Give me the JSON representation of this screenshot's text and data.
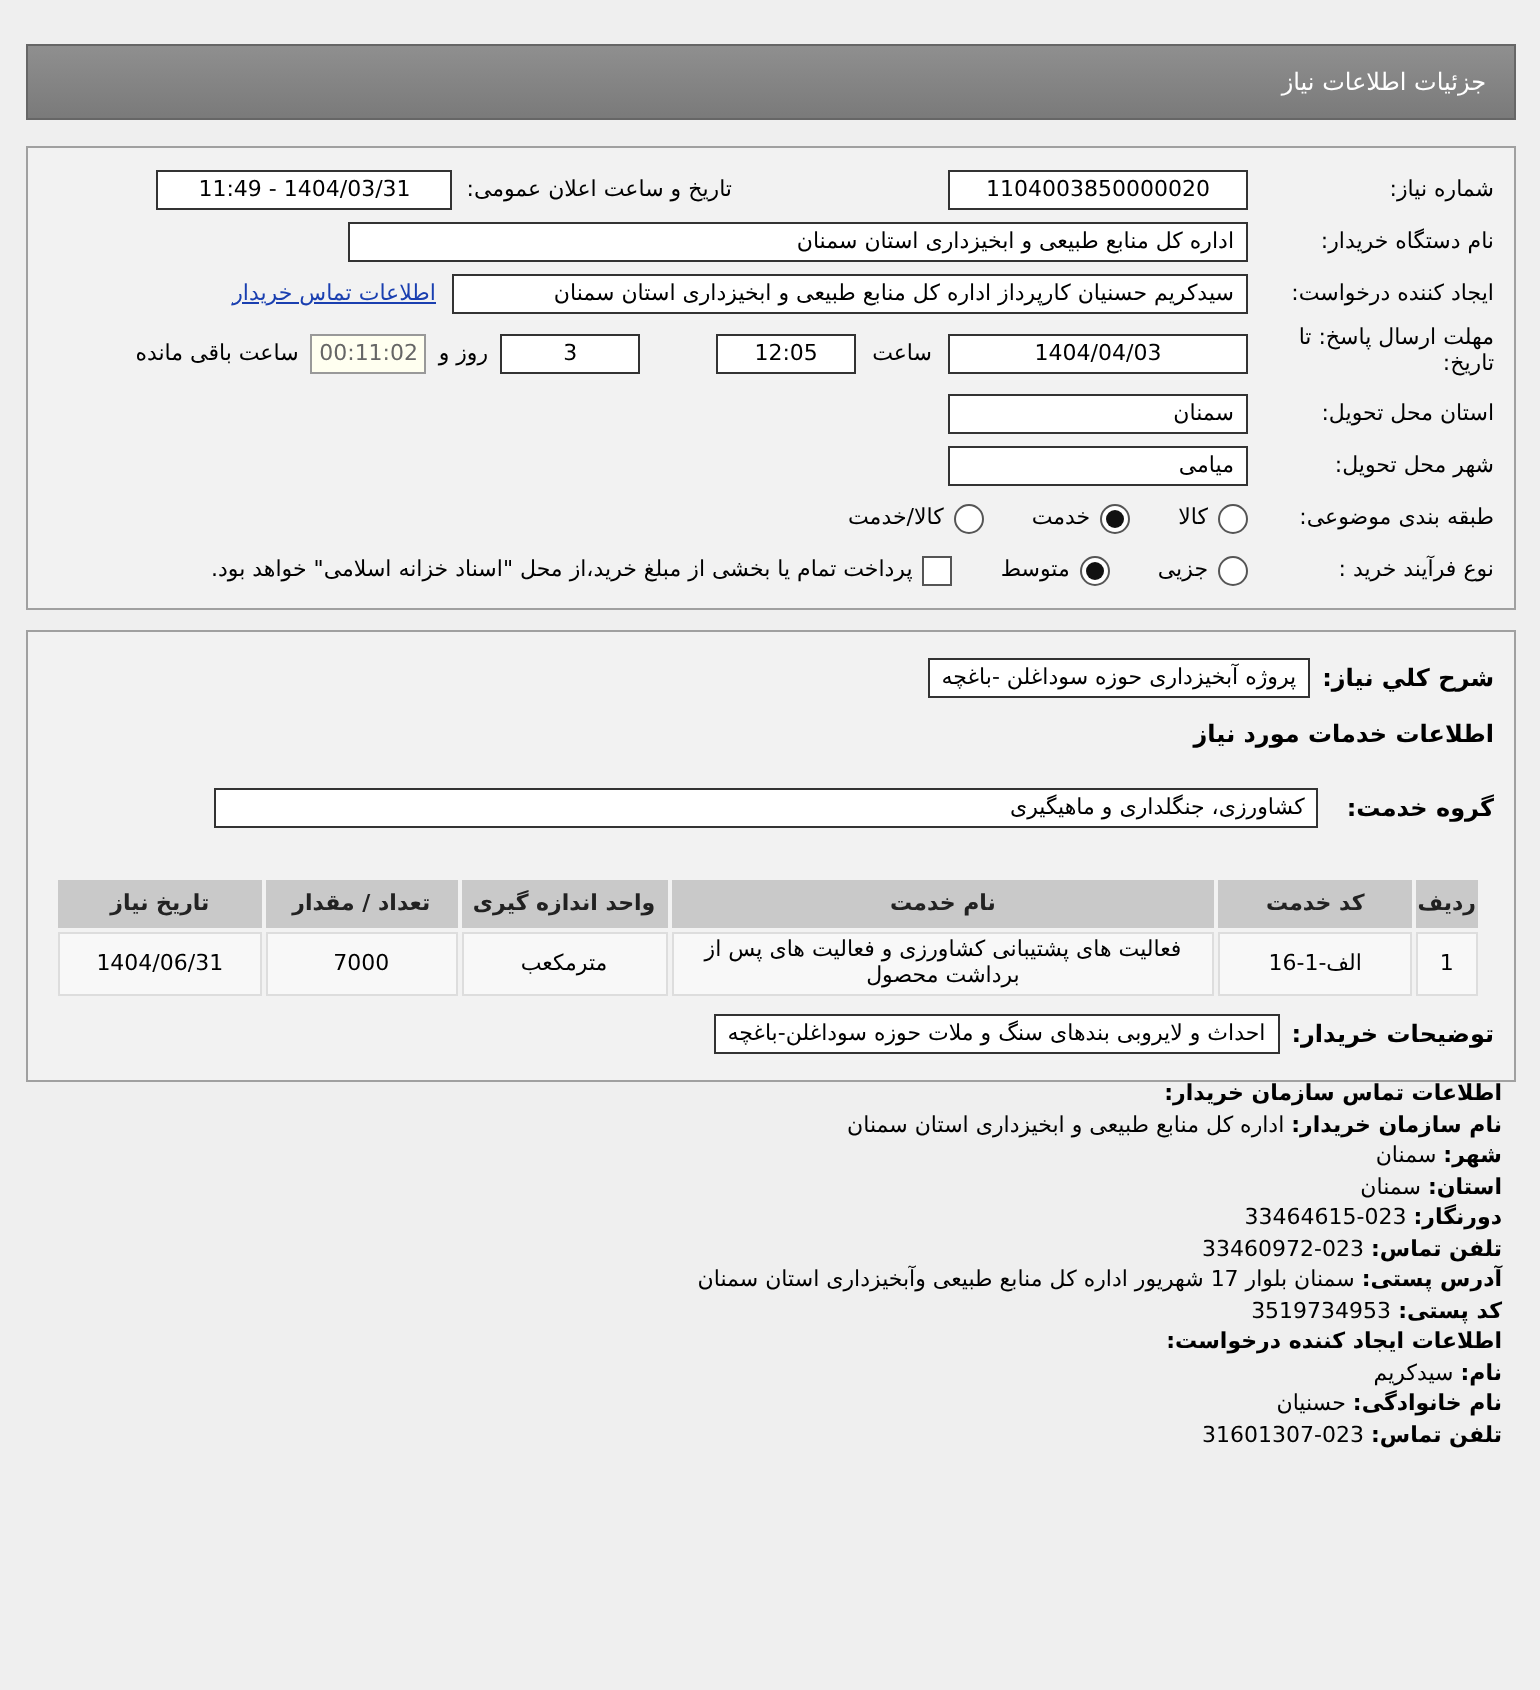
{
  "header": {
    "title": "جزئیات اطلاعات نیاز"
  },
  "details": {
    "need_number": {
      "label": "شماره نیاز:",
      "value": "1104003850000020"
    },
    "announce": {
      "label": "تاریخ و ساعت اعلان عمومی:",
      "value": "1404/03/31 - 11:49"
    },
    "buyer_org": {
      "label": "نام دستگاه خریدار:",
      "value": "اداره کل منابع طبیعی و ابخیزداری استان سمنان"
    },
    "requester": {
      "label": "ایجاد کننده درخواست:",
      "value": "سیدکریم حسنیان کارپرداز اداره کل منابع طبیعی و ابخیزداری استان سمنان",
      "link": "اطلاعات تماس خریدار"
    },
    "deadline": {
      "label": "مهلت ارسال پاسخ: تا تاریخ:",
      "date": "1404/04/03",
      "time_label": "ساعت",
      "time": "12:05",
      "days": "3",
      "days_label": "روز و",
      "remaining": "00:11:02",
      "remaining_label": "ساعت باقی مانده"
    },
    "province": {
      "label": "استان محل تحویل:",
      "value": "سمنان"
    },
    "city": {
      "label": "شهر محل تحویل:",
      "value": "میامی"
    },
    "category": {
      "label": "طبقه بندی موضوعی:",
      "options": [
        {
          "label": "کالا",
          "selected": false
        },
        {
          "label": "خدمت",
          "selected": true
        },
        {
          "label": "کالا/خدمت",
          "selected": false
        }
      ]
    },
    "process": {
      "label": "نوع فرآیند خرید :",
      "options": [
        {
          "label": "جزیی",
          "selected": false
        },
        {
          "label": "متوسط",
          "selected": true
        }
      ],
      "payment": {
        "label": "پرداخت تمام یا بخشی از مبلغ خرید،از محل \"اسناد خزانه اسلامی\" خواهد بود.",
        "checked": false
      }
    }
  },
  "services": {
    "summary": {
      "label": "شرح كلي نياز:",
      "value": "پروژه آبخیزداری حوزه سوداغلن -باغچه"
    },
    "section_title": "اطلاعات خدمات مورد نياز",
    "service_group": {
      "label": "گروه خدمت:",
      "value": "کشاورزی، جنگلداری و ماهیگیری"
    },
    "table": {
      "columns": [
        "ردیف",
        "کد خدمت",
        "نام خدمت",
        "واحد اندازه گیری",
        "تعداد / مقدار",
        "تاریخ نیاز"
      ],
      "rows": [
        [
          "1",
          "الف-1-16",
          "فعالیت های پشتیبانی کشاورزی و فعالیت های پس از برداشت محصول",
          "مترمکعب",
          "7000",
          "1404/06/31"
        ]
      ]
    },
    "buyer_notes": {
      "label": "توضیحات خریدار:",
      "value": "احداث و لایروبی بندهای سنگ و ملات حوزه سوداغلن-باغچه"
    }
  },
  "contact": [
    {
      "title": "اطلاعات تماس سازمان خریدار:",
      "items": [
        {
          "label": "نام سازمان خریدار:",
          "value": "اداره کل منابع طبیعی و ابخیزداری استان سمنان"
        },
        {
          "label": "شهر:",
          "value": "سمنان"
        },
        {
          "label": "استان:",
          "value": "سمنان"
        },
        {
          "label": "دورنگار:",
          "value": "023-33464615"
        },
        {
          "label": "تلفن تماس:",
          "value": "023-33460972"
        },
        {
          "label": "آدرس پستی:",
          "value": "سمنان بلوار 17 شهریور اداره کل منابع طبیعی وآبخیزداری استان سمنان"
        },
        {
          "label": "کد پستی:",
          "value": "3519734953"
        }
      ]
    },
    {
      "title": "اطلاعات ایجاد کننده درخواست:",
      "items": [
        {
          "label": "نام:",
          "value": "سیدکریم"
        },
        {
          "label": "نام خانوادگی:",
          "value": "حسنیان"
        },
        {
          "label": "تلفن تماس:",
          "value": "023-31601307"
        }
      ]
    }
  ]
}
